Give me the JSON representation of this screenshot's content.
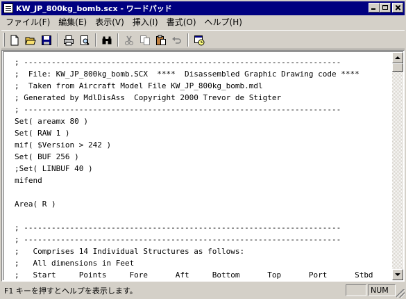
{
  "window": {
    "title": "KW_JP_800kg_bomb.scx - ワードパッド"
  },
  "menu": {
    "items": [
      {
        "label": "ファイル(F)"
      },
      {
        "label": "編集(E)"
      },
      {
        "label": "表示(V)"
      },
      {
        "label": "挿入(I)"
      },
      {
        "label": "書式(O)"
      },
      {
        "label": "ヘルプ(H)"
      }
    ]
  },
  "toolbar": {
    "buttons": [
      "new-icon",
      "open-icon",
      "save-icon",
      "print-icon",
      "print-preview-icon",
      "find-icon",
      "cut-icon",
      "copy-icon",
      "paste-icon",
      "undo-icon",
      "insert-datetime-icon"
    ]
  },
  "document": {
    "lines": [
      "; ---------------------------------------------------------------------",
      ";  File: KW_JP_800kg_bomb.SCX  ****  Disassembled Graphic Drawing code ****",
      ";  Taken from Aircraft Model File KW_JP_800kg_bomb.mdl",
      "; Generated by MdlDisAss  Copyright 2000 Trevor de Stigter",
      "; ---------------------------------------------------------------------",
      "Set( areamx 80 )",
      "Set( RAW 1 )",
      "mif( $Version > 242 )",
      "Set( BUF 256 )",
      ";Set( LINBUF 40 )",
      "mifend",
      "",
      "Area( R )",
      "",
      "; ---------------------------------------------------------------------",
      "; ---------------------------------------------------------------------",
      ";   Comprises 14 Individual Structures as follows:",
      ";   All dimensions in Feet",
      ";   Start     Points     Fore      Aft     Bottom      Top      Port      Stbd"
    ]
  },
  "status": {
    "text": "F1 キーを押すとヘルプを表示します。",
    "pane_empty": "",
    "num": "NUM"
  }
}
